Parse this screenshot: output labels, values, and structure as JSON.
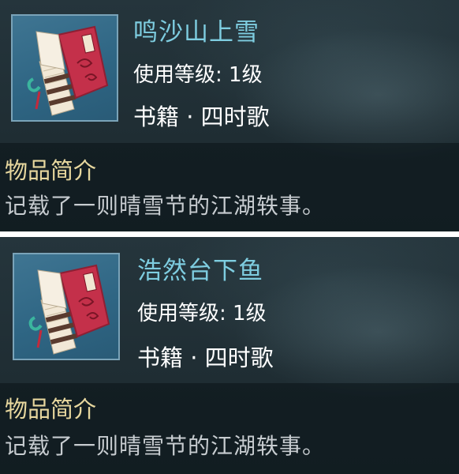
{
  "items": [
    {
      "name": "鸣沙山上雪",
      "level": "使用等级: 1级",
      "category": "书籍 · 四时歌",
      "desc_heading": "物品简介",
      "desc": "记载了一则晴雪节的江湖轶事。",
      "icon": "book-icon"
    },
    {
      "name": "浩然台下鱼",
      "level": "使用等级: 1级",
      "category": "书籍 · 四时歌",
      "desc_heading": "物品简介",
      "desc": "记载了一则晴雪节的江湖轶事。",
      "icon": "book-icon"
    }
  ],
  "colors": {
    "title": "#7ecde0",
    "heading": "#e7d79e",
    "text": "#c7ccd0",
    "panel": "#1f2d33"
  }
}
